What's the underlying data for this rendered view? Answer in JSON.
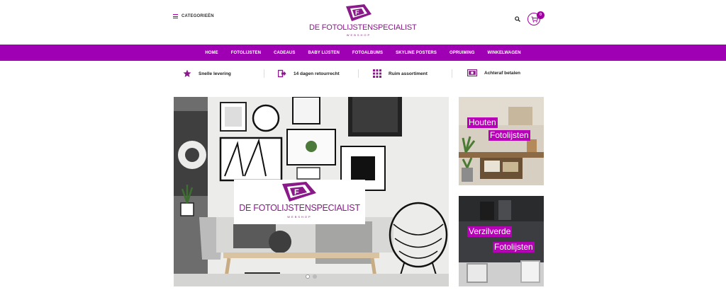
{
  "header": {
    "categories_label": "CATEGORIEËN",
    "logo": {
      "title": "DE FOTOLIJSTENSPECIALIST",
      "subtitle": "WEBSHOP",
      "mark_letter": "F"
    },
    "cart_count": "0"
  },
  "nav": {
    "items": [
      "HOME",
      "FOTOLIJSTEN",
      "CADEAUS",
      "BABY LIJSTEN",
      "FOTOALBUMS",
      "SKYLINE POSTERS",
      "OPRUIMING",
      "WINKELWAGEN"
    ]
  },
  "usp": {
    "items": [
      {
        "icon": "star-icon",
        "label": "Snelle levering"
      },
      {
        "icon": "return-icon",
        "label": "14 dagen retourrecht"
      },
      {
        "icon": "grid-icon",
        "label": "Ruim assortiment"
      },
      {
        "icon": "money-icon",
        "label": "Achteraf betalen"
      }
    ]
  },
  "hero": {
    "logo_title": "DE FOTOLIJSTENSPECIALIST",
    "logo_subtitle": "WEBSHOP",
    "mark_letter": "F"
  },
  "promos": [
    {
      "line1": "Houten",
      "line2": "Fotolijsten"
    },
    {
      "line1": "Verzilverde",
      "line2": "Fotolijsten"
    }
  ],
  "colors": {
    "brand": "#a000b4",
    "logo": "#8a1a8a"
  }
}
